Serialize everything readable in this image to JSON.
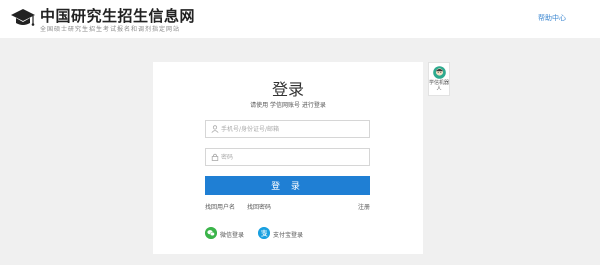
{
  "header": {
    "title": "中国研究生招生信息网",
    "subtitle": "全国硕士研究生招生考试报名和调剂指定网站",
    "help_link": "帮助中心"
  },
  "login": {
    "title": "登录",
    "subtitle": "请使用 学信网账号 进行登录",
    "username_placeholder": "手机号/身份证号/邮箱",
    "password_placeholder": "密码",
    "login_button": "登 录",
    "find_username": "找回用户名",
    "find_password": "找回密码",
    "register": "注册",
    "wechat_login": "微信登录",
    "alipay_login": "支付宝登录"
  },
  "robot": {
    "label": "学信机器人"
  },
  "colors": {
    "primary_button": "#1f7fd4",
    "link": "#3a86d1",
    "wechat": "#3bb44a",
    "alipay": "#1aa0e0",
    "page_bg": "#f0f0f0"
  },
  "icons": {
    "logo": "graduation-cap-icon",
    "username": "user-icon",
    "password": "lock-icon",
    "wechat": "wechat-icon",
    "alipay": "alipay-icon",
    "robot": "robot-icon"
  }
}
